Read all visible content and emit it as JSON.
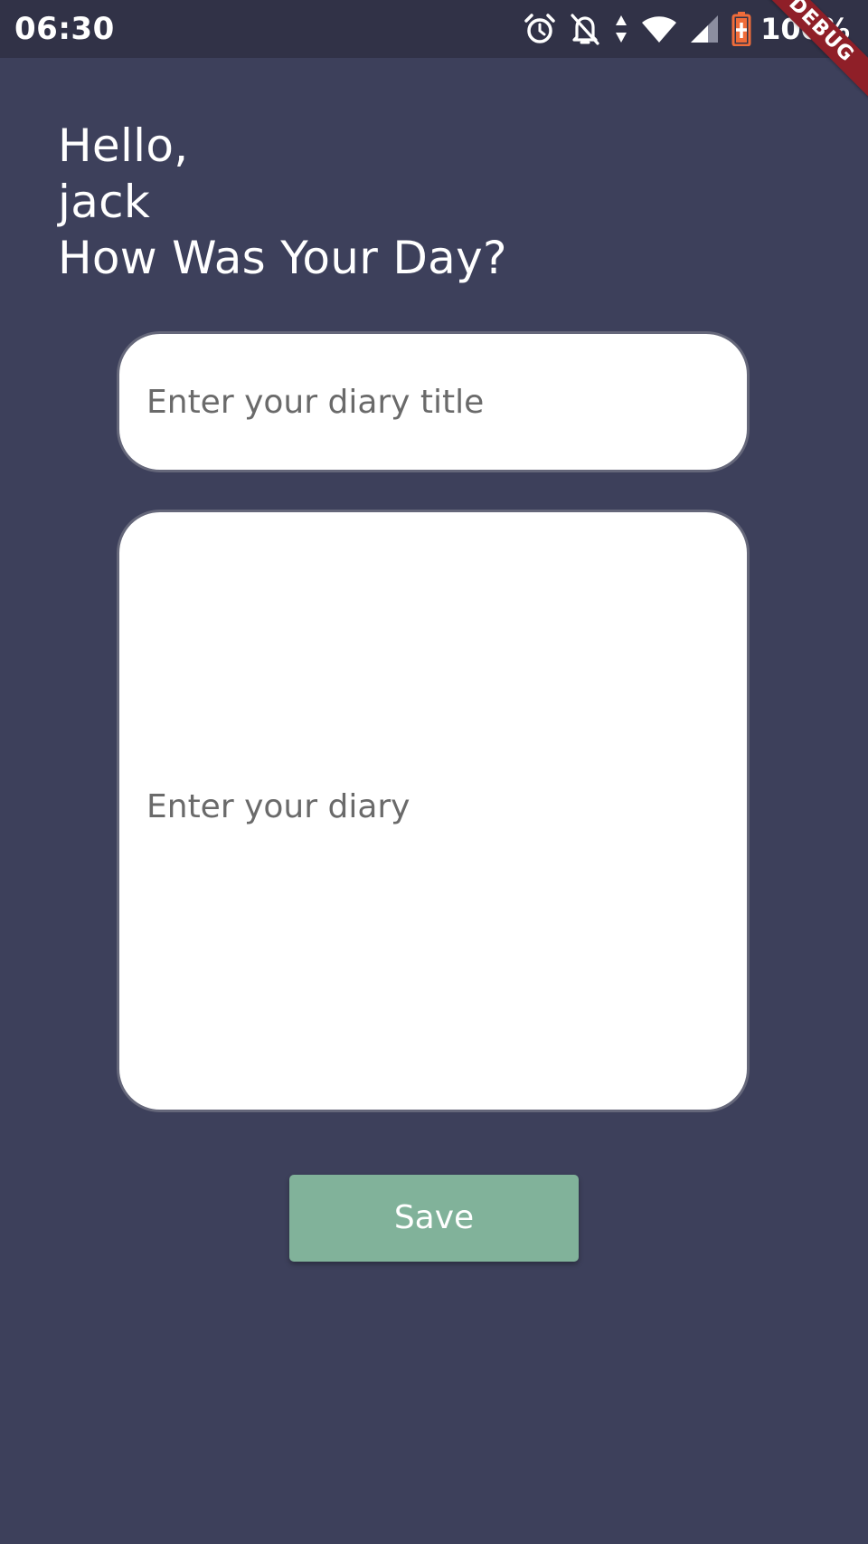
{
  "status_bar": {
    "time": "06:30",
    "battery": "100%",
    "icons": [
      "alarm-icon",
      "notifications-off-icon",
      "data-arrows-icon",
      "wifi-icon",
      "signal-icon",
      "battery-charging-icon"
    ]
  },
  "debug_banner": "DEBUG",
  "greeting": {
    "line1": "Hello,",
    "line2": "jack",
    "line3": "How Was Your Day?"
  },
  "title_input": {
    "value": "",
    "placeholder": "Enter your diary title"
  },
  "diary_input": {
    "value": "",
    "placeholder": "Enter your diary"
  },
  "save_button": {
    "label": "Save"
  },
  "colors": {
    "background": "#3d405b",
    "status_bar": "#313247",
    "button": "#81b29a",
    "field_border": "#65677a",
    "debug_banner": "#8f1f28",
    "battery_accent": "#ef6c3a"
  }
}
